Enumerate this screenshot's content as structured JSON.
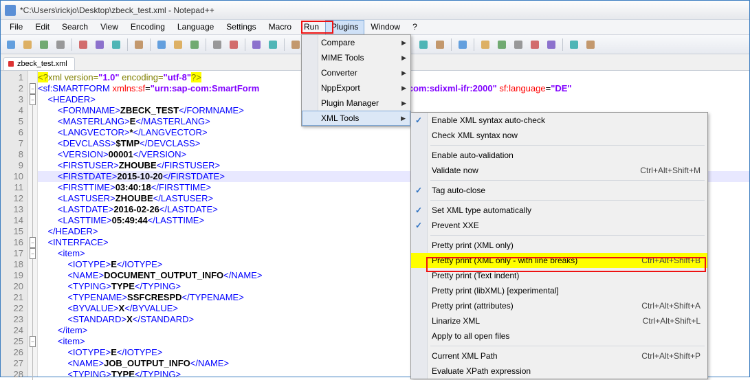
{
  "window": {
    "title": "*C:\\Users\\rickjo\\Desktop\\zbeck_test.xml - Notepad++"
  },
  "menubar": [
    "File",
    "Edit",
    "Search",
    "View",
    "Encoding",
    "Language",
    "Settings",
    "Macro",
    "Run",
    "Plugins",
    "Window",
    "?"
  ],
  "menubar_open_index": 9,
  "tab": {
    "name": "zbeck_test.xml"
  },
  "plugins_menu": [
    {
      "label": "Compare",
      "arrow": true
    },
    {
      "label": "MIME Tools",
      "arrow": true
    },
    {
      "label": "Converter",
      "arrow": true
    },
    {
      "label": "NppExport",
      "arrow": true
    },
    {
      "label": "Plugin Manager",
      "arrow": true
    },
    {
      "label": "XML Tools",
      "arrow": true,
      "hl": true
    }
  ],
  "xml_tools_menu": [
    {
      "label": "Enable XML syntax auto-check",
      "check": true
    },
    {
      "label": "Check XML syntax now"
    },
    {
      "sep": true
    },
    {
      "label": "Enable auto-validation"
    },
    {
      "label": "Validate now",
      "shortcut": "Ctrl+Alt+Shift+M"
    },
    {
      "sep": true
    },
    {
      "label": "Tag auto-close",
      "check": true
    },
    {
      "sep": true
    },
    {
      "label": "Set XML type automatically",
      "check": true
    },
    {
      "label": "Prevent XXE",
      "check": true
    },
    {
      "sep": true
    },
    {
      "label": "Pretty print (XML only)"
    },
    {
      "label": "Pretty print (XML only - with line breaks)",
      "shortcut": "Ctrl+Alt+Shift+B",
      "hl": true
    },
    {
      "label": "Pretty print (Text indent)"
    },
    {
      "label": "Pretty print (libXML) [experimental]"
    },
    {
      "label": "Pretty print (attributes)",
      "shortcut": "Ctrl+Alt+Shift+A"
    },
    {
      "label": "Linarize XML",
      "shortcut": "Ctrl+Alt+Shift+L"
    },
    {
      "label": "Apply to all open files"
    },
    {
      "sep": true
    },
    {
      "label": "Current XML Path",
      "shortcut": "Ctrl+Alt+Shift+P"
    },
    {
      "label": "Evaluate XPath expression"
    }
  ],
  "code": {
    "lines": [
      {
        "n": 1,
        "fold": "",
        "html": "<span class='hl-q hl-pi'>&lt;?</span><span class='hl-pi'>xml version=</span><span class='hl-str'>\"1.0\"</span><span class='hl-pi'> encoding=</span><span class='hl-str'>\"utf-8\"</span><span class='hl-q hl-pi'>?&gt;</span>"
      },
      {
        "n": 2,
        "fold": "m",
        "html": "<span class='hl-tag'>&lt;sf:SMARTFORM</span> <span class='hl-attr'>xmlns:sf</span>=<span class='hl-str'>\"urn:sap-com:SmartForm</span>                        <span class='hl-str'>ure\"</span> <span class='hl-attr'>xmlns</span>=<span class='hl-str'>\"urn:sap-com:sdixml-ifr:2000\"</span> <span class='hl-attr'>sf:language</span>=<span class='hl-str'>\"DE\"</span>"
      },
      {
        "n": 3,
        "fold": "m",
        "html": "    <span class='hl-tag'>&lt;HEADER&gt;</span>"
      },
      {
        "n": 4,
        "fold": "l",
        "html": "        <span class='hl-tag'>&lt;FORMNAME&gt;</span><span class='hl-txt'>ZBECK_TEST</span><span class='hl-tag'>&lt;/FORMNAME&gt;</span>"
      },
      {
        "n": 5,
        "fold": "l",
        "html": "        <span class='hl-tag'>&lt;MASTERLANG&gt;</span><span class='hl-txt'>E</span><span class='hl-tag'>&lt;/MASTERLANG&gt;</span>"
      },
      {
        "n": 6,
        "fold": "l",
        "html": "        <span class='hl-tag'>&lt;LANGVECTOR&gt;</span><span class='hl-txt'>*</span><span class='hl-tag'>&lt;/LANGVECTOR&gt;</span>"
      },
      {
        "n": 7,
        "fold": "l",
        "html": "        <span class='hl-tag'>&lt;DEVCLASS&gt;</span><span class='hl-txt'>$TMP</span><span class='hl-tag'>&lt;/DEVCLASS&gt;</span>"
      },
      {
        "n": 8,
        "fold": "l",
        "html": "        <span class='hl-tag'>&lt;VERSION&gt;</span><span class='hl-txt'>00001</span><span class='hl-tag'>&lt;/VERSION&gt;</span>"
      },
      {
        "n": 9,
        "fold": "l",
        "html": "        <span class='hl-tag'>&lt;FIRSTUSER&gt;</span><span class='hl-txt'>ZHOUBE</span><span class='hl-tag'>&lt;/FIRSTUSER&gt;</span>"
      },
      {
        "n": 10,
        "fold": "l",
        "sel": true,
        "html": "        <span class='hl-tag'>&lt;FIRSTDATE&gt;</span><span class='hl-txt'>2015-10-20</span><span class='hl-tag'>&lt;/FIRSTDATE&gt;</span>"
      },
      {
        "n": 11,
        "fold": "l",
        "html": "        <span class='hl-tag'>&lt;FIRSTTIME&gt;</span><span class='hl-txt'>03:40:18</span><span class='hl-tag'>&lt;/FIRSTTIME&gt;</span>"
      },
      {
        "n": 12,
        "fold": "l",
        "html": "        <span class='hl-tag'>&lt;LASTUSER&gt;</span><span class='hl-txt'>ZHOUBE</span><span class='hl-tag'>&lt;/LASTUSER&gt;</span>"
      },
      {
        "n": 13,
        "fold": "l",
        "html": "        <span class='hl-tag'>&lt;LASTDATE&gt;</span><span class='hl-txt'>2016-02-26</span><span class='hl-tag'>&lt;/LASTDATE&gt;</span>"
      },
      {
        "n": 14,
        "fold": "l",
        "html": "        <span class='hl-tag'>&lt;LASTTIME&gt;</span><span class='hl-txt'>05:49:44</span><span class='hl-tag'>&lt;/LASTTIME&gt;</span>"
      },
      {
        "n": 15,
        "fold": "l",
        "html": "    <span class='hl-tag'>&lt;/HEADER&gt;</span>"
      },
      {
        "n": 16,
        "fold": "m",
        "html": "    <span class='hl-tag'>&lt;INTERFACE&gt;</span>"
      },
      {
        "n": 17,
        "fold": "m",
        "html": "        <span class='hl-tag'>&lt;item&gt;</span>"
      },
      {
        "n": 18,
        "fold": "l",
        "html": "            <span class='hl-tag'>&lt;IOTYPE&gt;</span><span class='hl-txt'>E</span><span class='hl-tag'>&lt;/IOTYPE&gt;</span>"
      },
      {
        "n": 19,
        "fold": "l",
        "html": "            <span class='hl-tag'>&lt;NAME&gt;</span><span class='hl-txt'>DOCUMENT_OUTPUT_INFO</span><span class='hl-tag'>&lt;/NAME&gt;</span>"
      },
      {
        "n": 20,
        "fold": "l",
        "html": "            <span class='hl-tag'>&lt;TYPING&gt;</span><span class='hl-txt'>TYPE</span><span class='hl-tag'>&lt;/TYPING&gt;</span>"
      },
      {
        "n": 21,
        "fold": "l",
        "html": "            <span class='hl-tag'>&lt;TYPENAME&gt;</span><span class='hl-txt'>SSFCRESPD</span><span class='hl-tag'>&lt;/TYPENAME&gt;</span>"
      },
      {
        "n": 22,
        "fold": "l",
        "html": "            <span class='hl-tag'>&lt;BYVALUE&gt;</span><span class='hl-txt'>X</span><span class='hl-tag'>&lt;/BYVALUE&gt;</span>"
      },
      {
        "n": 23,
        "fold": "l",
        "html": "            <span class='hl-tag'>&lt;STANDARD&gt;</span><span class='hl-txt'>X</span><span class='hl-tag'>&lt;/STANDARD&gt;</span>"
      },
      {
        "n": 24,
        "fold": "l",
        "html": "        <span class='hl-tag'>&lt;/item&gt;</span>"
      },
      {
        "n": 25,
        "fold": "m",
        "html": "        <span class='hl-tag'>&lt;item&gt;</span>"
      },
      {
        "n": 26,
        "fold": "l",
        "html": "            <span class='hl-tag'>&lt;IOTYPE&gt;</span><span class='hl-txt'>E</span><span class='hl-tag'>&lt;/IOTYPE&gt;</span>"
      },
      {
        "n": 27,
        "fold": "l",
        "html": "            <span class='hl-tag'>&lt;NAME&gt;</span><span class='hl-txt'>JOB_OUTPUT_INFO</span><span class='hl-tag'>&lt;/NAME&gt;</span>"
      },
      {
        "n": 28,
        "fold": "l",
        "html": "            <span class='hl-tag'>&lt;TYPING&gt;</span><span class='hl-txt'>TYPE</span><span class='hl-tag'>&lt;/TYPING&gt;</span>"
      }
    ]
  },
  "toolbar_icons": [
    "new",
    "open",
    "save",
    "save-all",
    "close",
    "close-all",
    "print",
    "cut",
    "copy",
    "paste",
    "undo",
    "redo",
    "find",
    "replace",
    "zoom-in",
    "zoom-out",
    "sync",
    "wordwrap",
    "showall",
    "indent",
    "folder",
    "doc",
    "run",
    "record",
    "stop",
    "play",
    "fastforward",
    "saverec",
    "t1",
    "t2",
    "t3",
    "t4"
  ]
}
